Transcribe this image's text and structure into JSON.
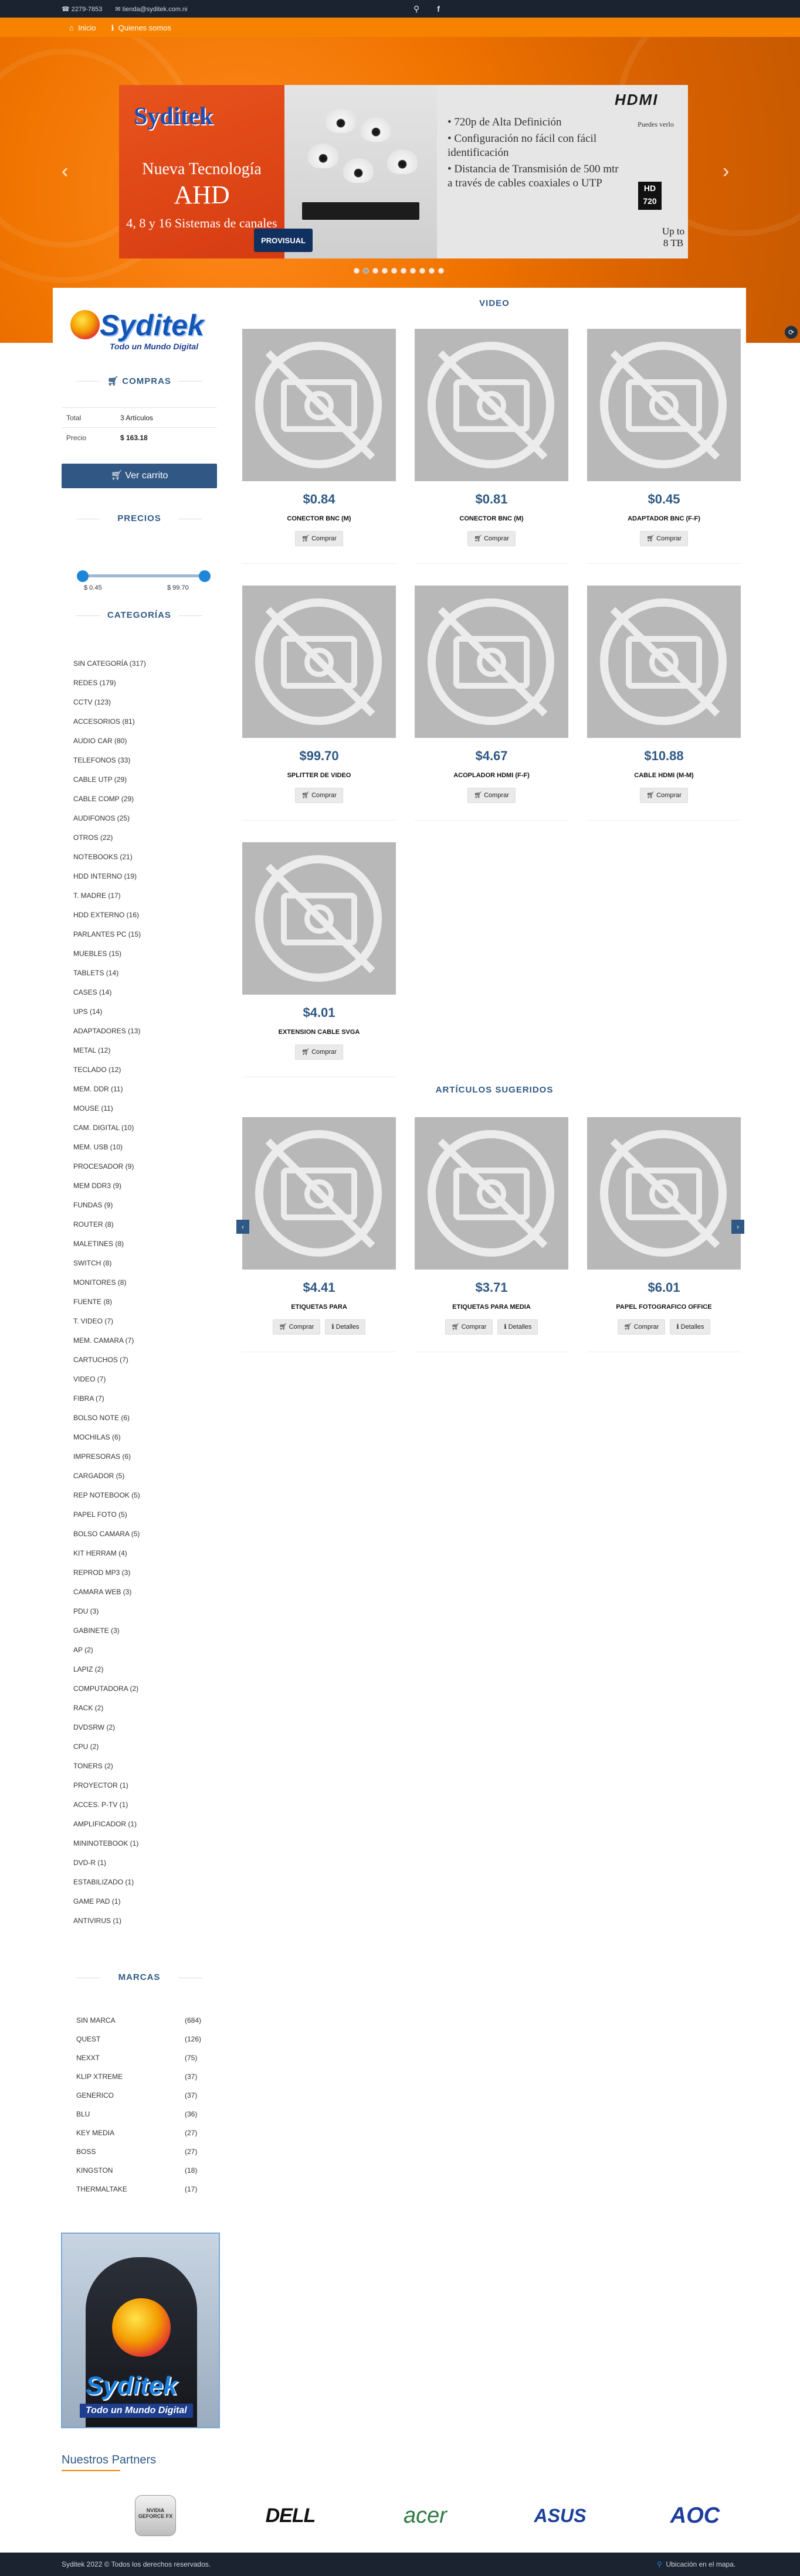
{
  "topbar": {
    "phone": "2279-7853",
    "email": "tienda@syditek.com.ni"
  },
  "nav": {
    "home": "Inicio",
    "about": "Quienes somos"
  },
  "banner": {
    "logo": "Syditek",
    "subtitle": "Nueva Tecnología",
    "tech": "AHD",
    "channels": "4, 8 y 16 Sistemas de canales",
    "features": [
      "720p de Alta Definición",
      "Configuración no fácil con fácil identificación",
      "Distancia de Transmisión de 500 mtr a través de cables coaxiales o UTP"
    ],
    "hdmi": "HDMI",
    "support": "Puedes verlo",
    "hd": "HD 720",
    "storage": "Up to 8 TB",
    "brand": "PROVISUAL"
  },
  "sidebar": {
    "logo": "Syditek",
    "logo_tag": "Todo un Mundo Digital",
    "cart_title": "COMPRAS",
    "cart_rows": [
      {
        "k": "Total",
        "v": "3 Artículos"
      },
      {
        "k": "Precio",
        "v": "$ 163.18"
      }
    ],
    "cart_btn": "Ver carrito",
    "price_title": "PRECIOS",
    "price_min": "$ 0.45",
    "price_max": "$ 99.70",
    "cat_title": "CATEGORÍAS",
    "cats": [
      "SIN CATEGORÍA (317)",
      "REDES (179)",
      "CCTV (123)",
      "ACCESORIOS (81)",
      "AUDIO CAR (80)",
      "TELEFONOS (33)",
      "CABLE UTP (29)",
      "CABLE COMP (29)",
      "AUDIFONOS (25)",
      "OTROS (22)",
      "NOTEBOOKS (21)",
      "HDD INTERNO (19)",
      "T. MADRE (17)",
      "HDD EXTERNO (16)",
      "PARLANTES PC (15)",
      "MUEBLES (15)",
      "TABLETS (14)",
      "CASES (14)",
      "UPS (14)",
      "ADAPTADORES (13)",
      "METAL (12)",
      "TECLADO (12)",
      "MEM. DDR (11)",
      "MOUSE (11)",
      "CAM. DIGITAL (10)",
      "MEM. USB (10)",
      "PROCESADOR (9)",
      "MEM DDR3 (9)",
      "FUNDAS (9)",
      "ROUTER (8)",
      "MALETINES (8)",
      "SWITCH (8)",
      "MONITORES (8)",
      "FUENTE (8)",
      "T. VIDEO (7)",
      "MEM. CAMARA (7)",
      "CARTUCHOS (7)",
      "VIDEO (7)",
      "FIBRA (7)",
      "BOLSO NOTE (6)",
      "MOCHILAS (6)",
      "IMPRESORAS (6)",
      "CARGADOR (5)",
      "REP NOTEBOOK (5)",
      "PAPEL FOTO (5)",
      "BOLSO CAMARA (5)",
      "KIT HERRAM (4)",
      "REPROD MP3 (3)",
      "CAMARA WEB (3)",
      "PDU (3)",
      "GABINETE (3)",
      "AP (2)",
      "LAPIZ (2)",
      "COMPUTADORA (2)",
      "RACK (2)",
      "DVDsRW (2)",
      "CPU (2)",
      "TONERS (2)",
      "PROYECTOR (1)",
      "ACCES. P-TV (1)",
      "AMPLIFICADOR (1)",
      "MININOTEBOOK (1)",
      "DVD-R (1)",
      "ESTABILIZADO (1)",
      "GAME PAD (1)",
      "ANTIVIRUS (1)"
    ],
    "brand_title": "MARCAS",
    "brands": [
      {
        "n": "SIN MARCA",
        "c": "(684)"
      },
      {
        "n": "QUEST",
        "c": "(126)"
      },
      {
        "n": "NEXXT",
        "c": "(75)"
      },
      {
        "n": "KLIP XTREME",
        "c": "(37)"
      },
      {
        "n": "GENERICO",
        "c": "(37)"
      },
      {
        "n": "BLU",
        "c": "(36)"
      },
      {
        "n": "KEY MEDIA",
        "c": "(27)"
      },
      {
        "n": "BOSS",
        "c": "(27)"
      },
      {
        "n": "KINGSTON",
        "c": "(18)"
      },
      {
        "n": "THERMALTAKE",
        "c": "(17)"
      }
    ],
    "promo_logo": "Syditek",
    "promo_tag": "Todo un Mundo Digital"
  },
  "video_title": "VIDEO",
  "products": [
    {
      "price": "$0.84",
      "name": "CONECTOR BNC (M)",
      "buy": "Comprar"
    },
    {
      "price": "$0.81",
      "name": "CONECTOR BNC (M)",
      "buy": "Comprar"
    },
    {
      "price": "$0.45",
      "name": "ADAPTADOR BNC (F-F)",
      "buy": "Comprar"
    },
    {
      "price": "$99.70",
      "name": "SPLITTER DE VIDEO",
      "buy": "Comprar"
    },
    {
      "price": "$4.67",
      "name": "ACOPLADOR HDMI (F-F)",
      "buy": "Comprar"
    },
    {
      "price": "$10.88",
      "name": "CABLE HDMI (M-M)",
      "buy": "Comprar"
    },
    {
      "price": "$4.01",
      "name": "EXTENSION CABLE SVGA",
      "buy": "Comprar"
    }
  ],
  "suggest_title": "ARTÍCULOS SUGERIDOS",
  "suggested": [
    {
      "price": "$4.41",
      "name": "ETIQUETAS PARA",
      "buy": "Comprar",
      "details": "Detalles"
    },
    {
      "price": "$3.71",
      "name": "ETIQUETAS PARA MEDIA",
      "buy": "Comprar",
      "details": "Detalles"
    },
    {
      "price": "$6.01",
      "name": "PAPEL FOTOGRAFICO OFFICE",
      "buy": "Comprar",
      "details": "Detalles"
    }
  ],
  "partners": {
    "title": "Nuestros Partners",
    "logos": [
      "NVIDIA GEFORCE FX",
      "DELL",
      "acer",
      "ASUS",
      "AOC"
    ]
  },
  "footer": {
    "copyright": "Syditek 2022 © Todos los derechos reservados.",
    "map": "Ubicación en el mapa."
  },
  "colors": {
    "accent": "#f78200",
    "primary": "#2f5984",
    "dark": "#1b2330"
  }
}
